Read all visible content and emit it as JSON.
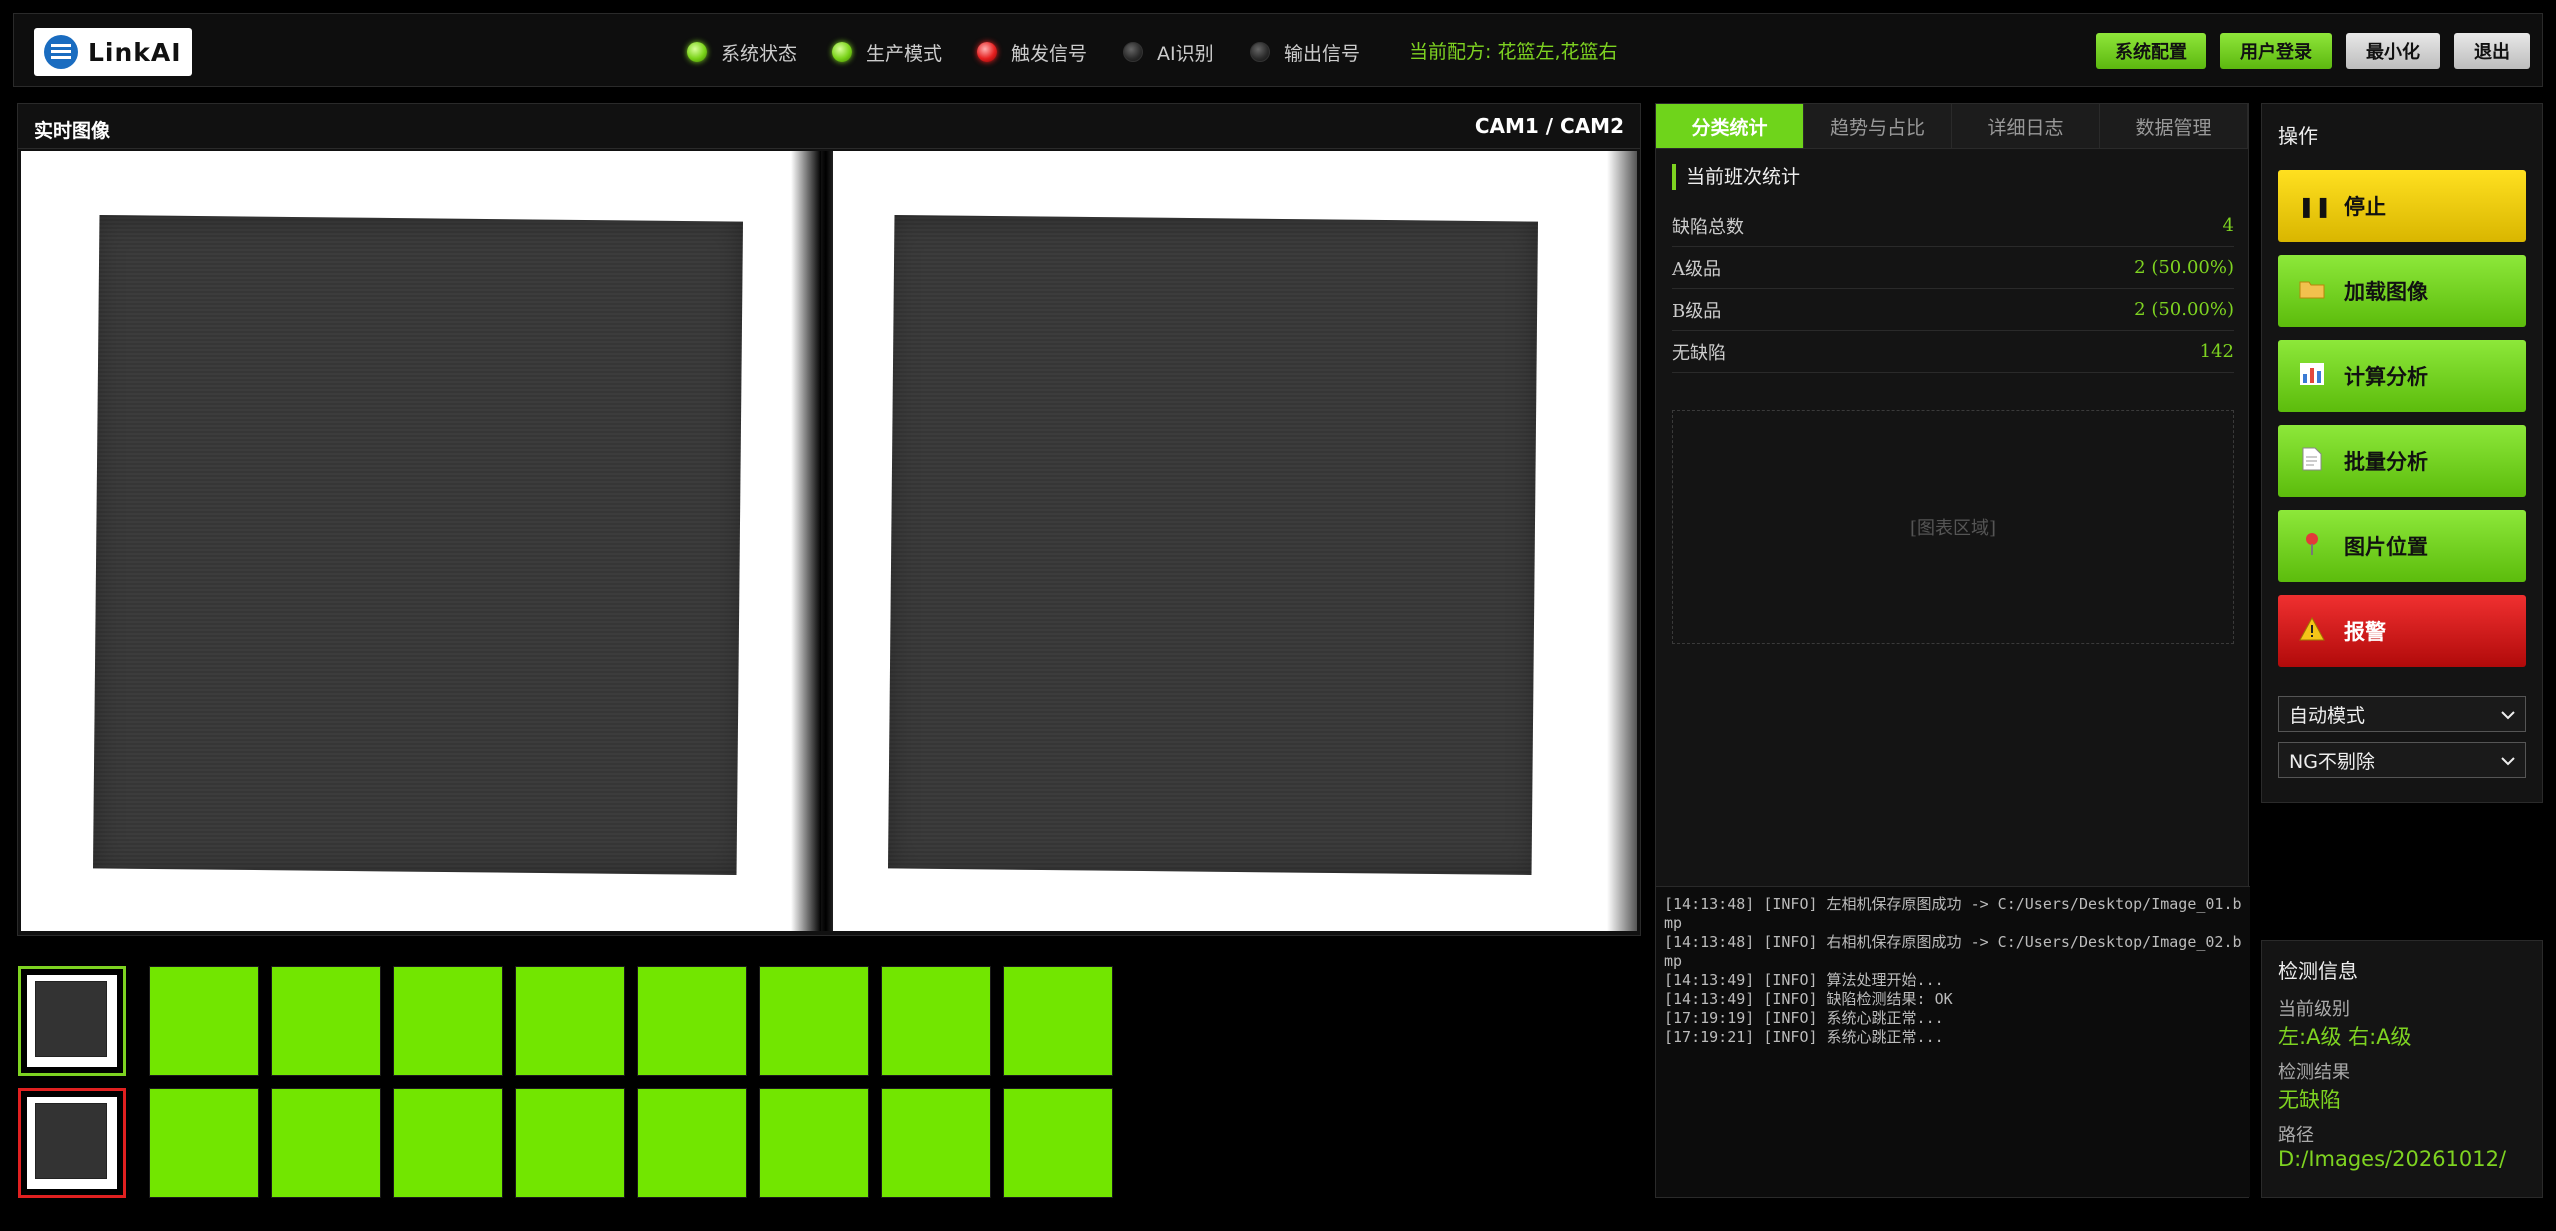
{
  "header": {
    "logo_text": "LinkAI",
    "indicators": [
      {
        "label": "系统状态",
        "state": "green"
      },
      {
        "label": "生产模式",
        "state": "green"
      },
      {
        "label": "触发信号",
        "state": "red"
      },
      {
        "label": "AI识别",
        "state": "off"
      },
      {
        "label": "输出信号",
        "state": "off"
      }
    ],
    "recipe": "当前配方: 花篮左,花篮右",
    "buttons": {
      "config": "系统配置",
      "login": "用户登录",
      "minimize": "最小化",
      "exit": "退出"
    }
  },
  "image_panel": {
    "title": "实时图像",
    "camera_label": "CAM1 / CAM2"
  },
  "tabs": [
    "分类统计",
    "趋势与占比",
    "详细日志",
    "数据管理"
  ],
  "stats": {
    "section_title": "当前班次统计",
    "rows": [
      {
        "label": "缺陷总数",
        "value": "4"
      },
      {
        "label": "A级品",
        "value": "2 (50.00%)"
      },
      {
        "label": "B级品",
        "value": "2 (50.00%)"
      },
      {
        "label": "无缺陷",
        "value": "142"
      }
    ],
    "chart_placeholder": "[图表区域]"
  },
  "log": [
    "[14:13:48] [INFO] 左相机保存原图成功 -> C:/Users/Desktop/Image_01.bmp",
    "[14:13:48] [INFO] 右相机保存原图成功 -> C:/Users/Desktop/Image_02.bmp",
    "[14:13:49] [INFO] 算法处理开始...",
    "[14:13:49] [INFO] 缺陷检测结果: OK",
    "[17:19:19] [INFO] 系统心跳正常...",
    "[17:19:21] [INFO] 系统心跳正常..."
  ],
  "operations": {
    "title": "操作",
    "buttons": [
      {
        "label": "停止",
        "icon": "pause-icon",
        "color": "yellow"
      },
      {
        "label": "加载图像",
        "icon": "folder-icon",
        "color": "green"
      },
      {
        "label": "计算分析",
        "icon": "bar-chart-icon",
        "color": "green"
      },
      {
        "label": "批量分析",
        "icon": "document-icon",
        "color": "green"
      },
      {
        "label": "图片位置",
        "icon": "pin-icon",
        "color": "green"
      },
      {
        "label": "报警",
        "icon": "warning-icon",
        "color": "red"
      }
    ],
    "mode_select": "自动模式",
    "ng_select": "NG不剔除"
  },
  "detection_info": {
    "title": "检测信息",
    "level_label": "当前级别",
    "level_value": "左:A级 右:A级",
    "result_label": "检测结果",
    "result_value": "无缺陷",
    "path_label": "路径",
    "path_value": "D:/Images/20261012/"
  },
  "colors": {
    "accent_green": "#7ed321",
    "alarm_red": "#e02020",
    "stop_yellow": "#f0cc0a"
  }
}
